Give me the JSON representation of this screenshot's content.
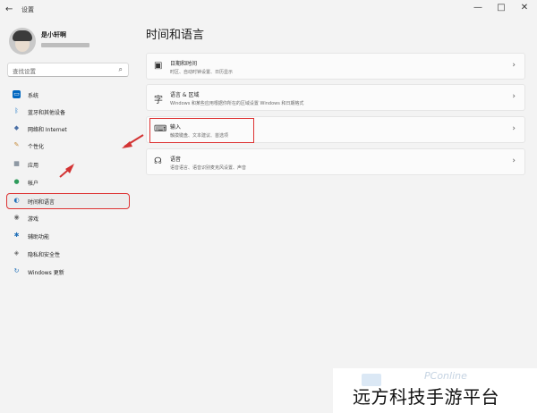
{
  "window": {
    "title": "设置",
    "back_icon": "back-arrow-icon",
    "controls": [
      "—",
      "□",
      "✕"
    ]
  },
  "account": {
    "name": "是小轩啊"
  },
  "search": {
    "placeholder": "查找设置"
  },
  "sidebar": {
    "items": [
      {
        "label": "系统",
        "icon": "system-icon",
        "color": "#0067c0"
      },
      {
        "label": "蓝牙和其他设备",
        "icon": "bluetooth-icon",
        "color": "#0067c0"
      },
      {
        "label": "网络和 Internet",
        "icon": "network-icon",
        "color": "#4a6fa5"
      },
      {
        "label": "个性化",
        "icon": "brush-icon",
        "color": "#c58b3b"
      },
      {
        "label": "应用",
        "icon": "apps-icon",
        "color": "#556677"
      },
      {
        "label": "帐户",
        "icon": "account-icon",
        "color": "#2e9b5b"
      },
      {
        "label": "时间和语言",
        "icon": "time-language-icon",
        "color": "#1f6fb8",
        "selected": true
      },
      {
        "label": "游戏",
        "icon": "gaming-icon",
        "color": "#6b6b6b"
      },
      {
        "label": "辅助功能",
        "icon": "accessibility-icon",
        "color": "#1f6fb8"
      },
      {
        "label": "隐私和安全性",
        "icon": "privacy-shield-icon",
        "color": "#6b6b6b"
      },
      {
        "label": "Windows 更新",
        "icon": "windows-update-icon",
        "color": "#1f6fb8"
      }
    ]
  },
  "main": {
    "title": "时间和语言",
    "cards": [
      {
        "title": "日期和时间",
        "desc": "时区、自动时钟设置、日历显示",
        "icon": "clock-calendar-icon"
      },
      {
        "title": "语言 & 区域",
        "desc": "Windows 和某些应用根据你所在的区域设置 Windows 和日期格式",
        "icon": "language-region-icon"
      },
      {
        "title": "输入",
        "desc": "触摸键盘、文本建议、首选项",
        "icon": "keyboard-icon"
      },
      {
        "title": "语音",
        "desc": "语音语言、语音识别麦克风设置、声音",
        "icon": "speech-icon"
      }
    ]
  },
  "watermark": {
    "brand": "PConline",
    "text": "远方科技手游平台"
  },
  "annotation_color": "#d33333"
}
